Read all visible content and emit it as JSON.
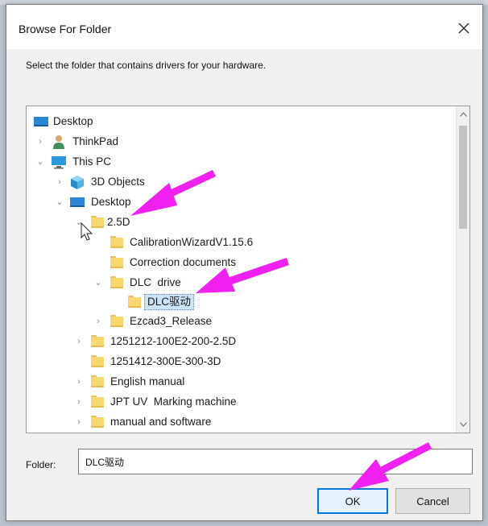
{
  "dialog": {
    "title": "Browse For Folder",
    "instruction": "Select the folder that contains drivers for your hardware.",
    "folder_label": "Folder:",
    "folder_value": "DLC驱动",
    "ok_label": "OK",
    "cancel_label": "Cancel"
  },
  "tree": {
    "items": [
      {
        "label": "Desktop",
        "icon": "desktop-icon",
        "expander": "none"
      },
      {
        "label": "ThinkPad",
        "icon": "user-icon",
        "expander": "collapsed"
      },
      {
        "label": "This PC",
        "icon": "computer-icon",
        "expander": "expanded"
      },
      {
        "label": "3D Objects",
        "icon": "3d-objects-icon",
        "expander": "collapsed"
      },
      {
        "label": "Desktop",
        "icon": "desktop-icon",
        "expander": "expanded"
      },
      {
        "label": "2.5D",
        "icon": "folder-icon",
        "expander": "expanded"
      },
      {
        "label": "CalibrationWizardV1.15.6",
        "icon": "folder-icon",
        "expander": "none"
      },
      {
        "label": "Correction documents",
        "icon": "folder-icon",
        "expander": "none"
      },
      {
        "label": "DLC  drive",
        "icon": "folder-icon",
        "expander": "expanded"
      },
      {
        "label": "DLC驱动",
        "icon": "folder-icon",
        "expander": "none",
        "selected": true
      },
      {
        "label": "Ezcad3_Release",
        "icon": "folder-icon",
        "expander": "collapsed"
      },
      {
        "label": "1251212-100E2-200-2.5D",
        "icon": "folder-icon",
        "expander": "collapsed"
      },
      {
        "label": "1251412-300E-300-3D",
        "icon": "folder-icon",
        "expander": "none"
      },
      {
        "label": "English manual",
        "icon": "folder-icon",
        "expander": "collapsed"
      },
      {
        "label": "JPT UV  Marking machine",
        "icon": "folder-icon",
        "expander": "collapsed"
      },
      {
        "label": "manual and software",
        "icon": "folder-icon",
        "expander": "collapsed"
      }
    ]
  },
  "colors": {
    "accent": "#0078d7",
    "annotation_arrow": "#f020f0",
    "selection": "#cce4f7"
  }
}
